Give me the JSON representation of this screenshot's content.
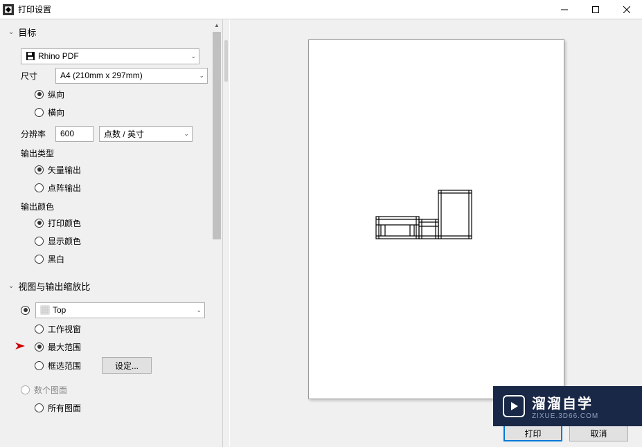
{
  "window": {
    "title": "打印设置"
  },
  "sections": {
    "target": {
      "header": "目标",
      "printer": "Rhino PDF",
      "size_label": "尺寸",
      "size_value": "A4 (210mm x 297mm)",
      "orientation": {
        "portrait": "纵向",
        "landscape": "横向"
      },
      "resolution_label": "分辨率",
      "resolution_value": "600",
      "resolution_unit": "点数 / 英寸",
      "output_type_label": "输出类型",
      "output_type": {
        "vector": "矢量输出",
        "raster": "点阵输出"
      },
      "output_color_label": "输出颜色",
      "output_color": {
        "print": "打印颜色",
        "display": "显示颜色",
        "bw": "黑白"
      }
    },
    "view": {
      "header": "视图与输出缩放比",
      "viewport": "Top",
      "range": {
        "viewport": "工作视窗",
        "extents": "最大范围",
        "window": "框选范围",
        "set_btn": "设定..."
      },
      "multi": {
        "multiple": "数个图面",
        "all": "所有图面"
      }
    }
  },
  "buttons": {
    "print": "打印",
    "cancel": "取消"
  },
  "watermark": {
    "main": "溜溜自学",
    "sub": "ZIXUE.3D66.COM"
  }
}
